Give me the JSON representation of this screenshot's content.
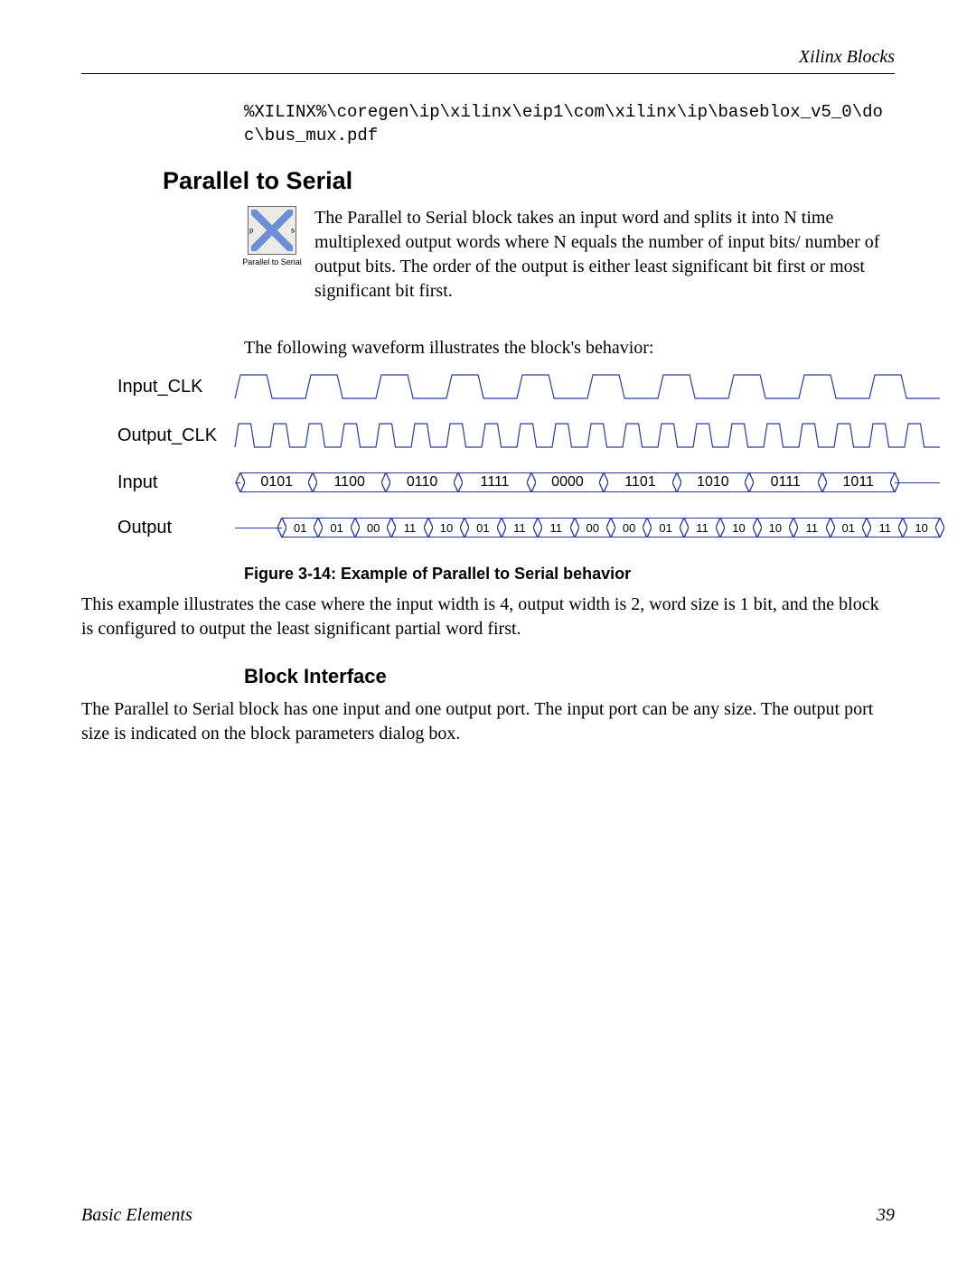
{
  "header": {
    "running_head": "Xilinx Blocks"
  },
  "path": {
    "line1": "%XILINX%\\coregen\\ip\\xilinx\\eip1\\com\\xilinx\\ip\\baseblox_v5_0\\do",
    "line2": "c\\bus_mux.pdf"
  },
  "section": {
    "title": "Parallel to Serial",
    "icon_caption": "Parallel to Serial",
    "icon_port_left": "p",
    "icon_port_right": "s",
    "intro": "The Parallel to Serial block takes an input word and splits it into N time multiplexed output words where N equals the number of input bits/ number of output bits.  The order of the output is either least significant bit first or most significant bit first.",
    "wave_lead": "The following waveform illustrates the block's behavior:"
  },
  "waveform": {
    "labels": {
      "input_clk": "Input_CLK",
      "output_clk": "Output_CLK",
      "input": "Input",
      "output": "Output"
    },
    "input_values": [
      "0101",
      "1100",
      "0110",
      "1111",
      "0000",
      "1101",
      "1010",
      "0111",
      "1011"
    ],
    "output_values": [
      "01",
      "01",
      "00",
      "11",
      "10",
      "01",
      "11",
      "11",
      "00",
      "00",
      "01",
      "11",
      "10",
      "10",
      "11",
      "01",
      "11",
      "10"
    ]
  },
  "figure": {
    "caption": "Figure 3-14:   Example of Parallel to Serial behavior",
    "explain": "This example illustrates the case where the input width is 4, output width is 2, word size is 1 bit, and the block is configured to output the least significant partial word first."
  },
  "interface": {
    "heading": "Block Interface",
    "body": "The Parallel to Serial block has one input and one output port.  The input port can be any size. The output port size is indicated on the block parameters dialog box."
  },
  "footer": {
    "left": "Basic Elements",
    "right": "39"
  }
}
